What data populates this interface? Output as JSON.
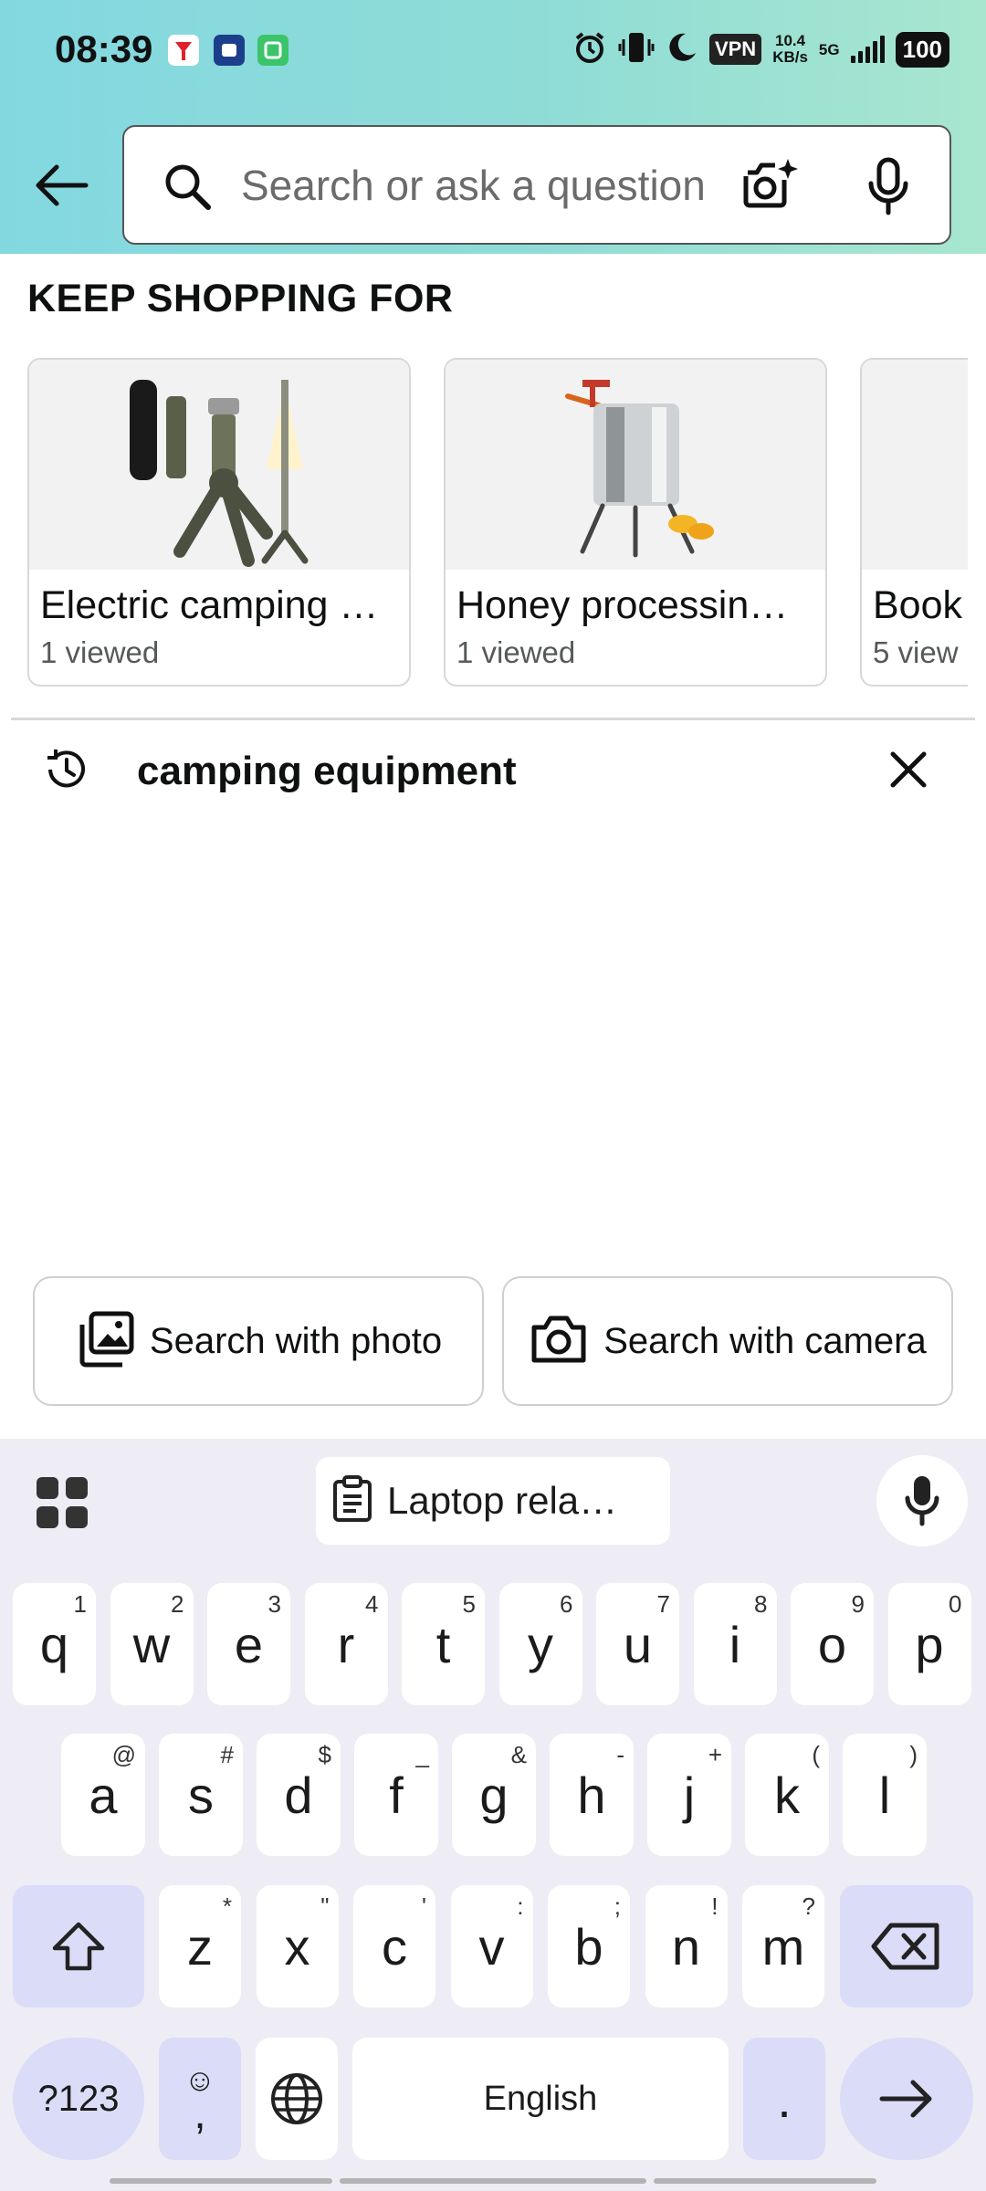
{
  "status_bar": {
    "time": "08:39",
    "vpn": "VPN",
    "speed_value": "10.4",
    "speed_unit": "KB/s",
    "network": "5G",
    "battery": "100",
    "icons": [
      "alarm-icon",
      "vibrate-icon",
      "moon-icon",
      "signal-icon"
    ]
  },
  "search": {
    "placeholder": "Search or ask a question"
  },
  "keep_shopping": {
    "title": "KEEP SHOPPING FOR",
    "cards": [
      {
        "title": "Electric camping …",
        "sub": "1 viewed"
      },
      {
        "title": "Honey processin…",
        "sub": "1 viewed"
      },
      {
        "title": "Book",
        "sub": "5 view"
      }
    ]
  },
  "history": {
    "query": "camping equipment"
  },
  "actions": {
    "photo_label": "Search with photo",
    "camera_label": "Search with camera"
  },
  "keyboard": {
    "clipboard_label": "Laptop rela…",
    "row1": [
      {
        "k": "q",
        "h": "1"
      },
      {
        "k": "w",
        "h": "2"
      },
      {
        "k": "e",
        "h": "3"
      },
      {
        "k": "r",
        "h": "4"
      },
      {
        "k": "t",
        "h": "5"
      },
      {
        "k": "y",
        "h": "6"
      },
      {
        "k": "u",
        "h": "7"
      },
      {
        "k": "i",
        "h": "8"
      },
      {
        "k": "o",
        "h": "9"
      },
      {
        "k": "p",
        "h": "0"
      }
    ],
    "row2": [
      {
        "k": "a",
        "h": "@"
      },
      {
        "k": "s",
        "h": "#"
      },
      {
        "k": "d",
        "h": "$"
      },
      {
        "k": "f",
        "h": "_"
      },
      {
        "k": "g",
        "h": "&"
      },
      {
        "k": "h",
        "h": "-"
      },
      {
        "k": "j",
        "h": "+"
      },
      {
        "k": "k",
        "h": "("
      },
      {
        "k": "l",
        "h": ")"
      }
    ],
    "row3": [
      {
        "k": "z",
        "h": "*"
      },
      {
        "k": "x",
        "h": "\""
      },
      {
        "k": "c",
        "h": "'"
      },
      {
        "k": "v",
        "h": ":"
      },
      {
        "k": "b",
        "h": ";"
      },
      {
        "k": "n",
        "h": "!"
      },
      {
        "k": "m",
        "h": "?"
      }
    ],
    "symbols_label": "?123",
    "comma_label": ",",
    "emoji_hint": "☺",
    "space_label": "English",
    "period_label": "."
  },
  "colors": {
    "header_gradient_start": "#83d8e0",
    "header_gradient_end": "#a8e6cf",
    "keyboard_bg": "#eeedf5",
    "modifier_key": "#dbdcf7"
  }
}
